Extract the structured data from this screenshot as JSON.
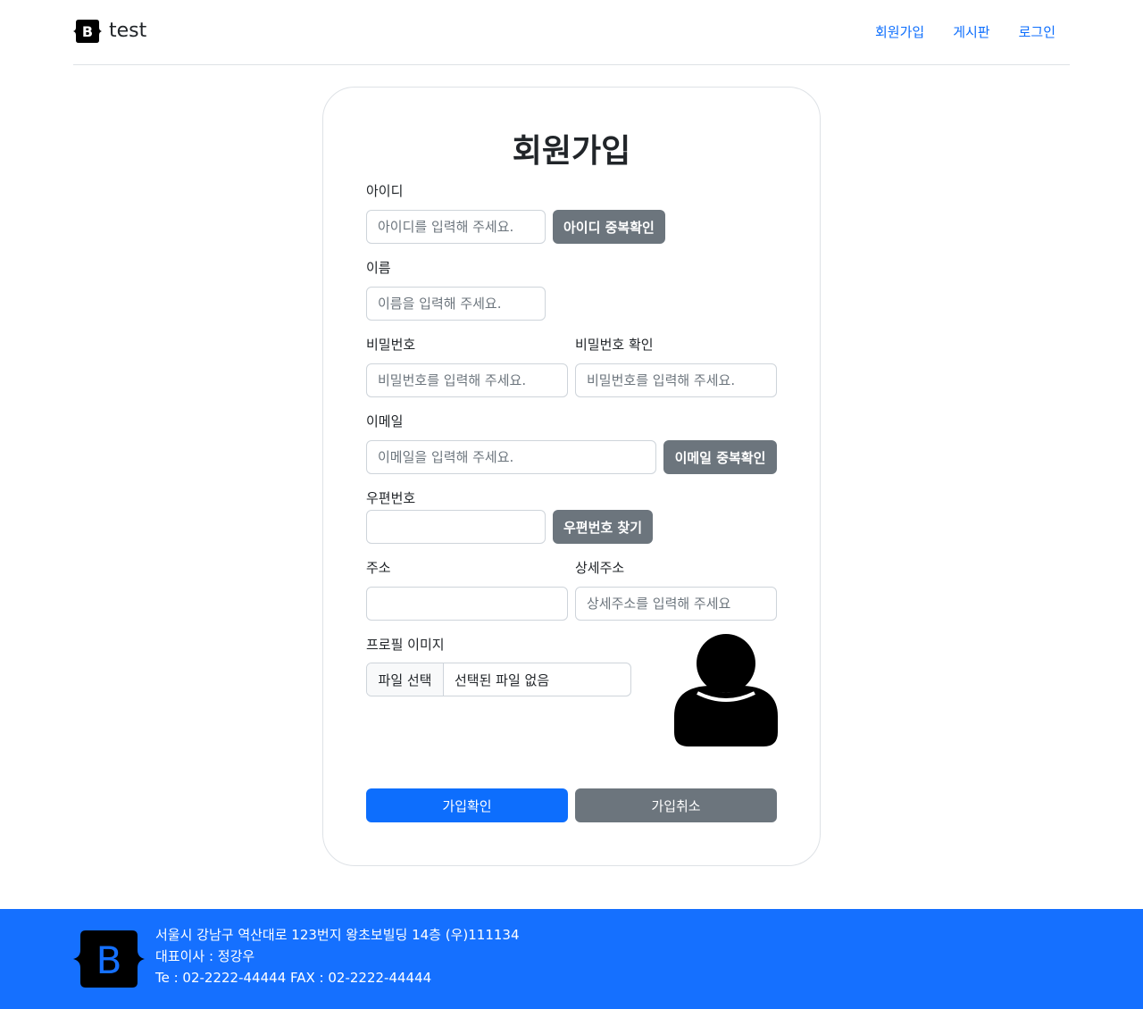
{
  "header": {
    "brand_text": "test",
    "brand_letter": "B",
    "nav": [
      "회원가입",
      "게시판",
      "로그인"
    ]
  },
  "form": {
    "title": "회원가입",
    "id_label": "아이디",
    "id_placeholder": "아이디를 입력해 주세요.",
    "id_check_button": "아이디 중복확인",
    "name_label": "이름",
    "name_placeholder": "이름을 입력해 주세요.",
    "password_label": "비밀번호",
    "password_placeholder": "비밀번호를 입력해 주세요.",
    "password_confirm_label": "비밀번호 확인",
    "password_confirm_placeholder": "비밀번호를 입력해 주세요.",
    "email_label": "이메일",
    "email_placeholder": "이메일을 입력해 주세요.",
    "email_check_button": "이메일 중복확인",
    "zipcode_label": "우편번호",
    "zipcode_value": "",
    "zipcode_button": "우편번호 찾기",
    "address_label": "주소",
    "address_value": "",
    "detail_address_label": "상세주소",
    "detail_address_placeholder": "상세주소를 입력해 주세요",
    "profile_label": "프로필 이미지",
    "file_button": "파일 선택",
    "file_status": "선택된 파일 없음",
    "submit_button": "가입확인",
    "cancel_button": "가입취소"
  },
  "footer": {
    "brand_letter": "B",
    "address": "서울시 강남구 역산대로 123번지 왕초보빌딩 14층 (우)111134",
    "ceo": "대표이사 : 정강우",
    "contact": "Te : 02-2222-44444 FAX : 02-2222-44444"
  },
  "colors": {
    "primary": "#0d6efd",
    "secondary": "#6c757d",
    "footer_bg": "#1570ff"
  }
}
